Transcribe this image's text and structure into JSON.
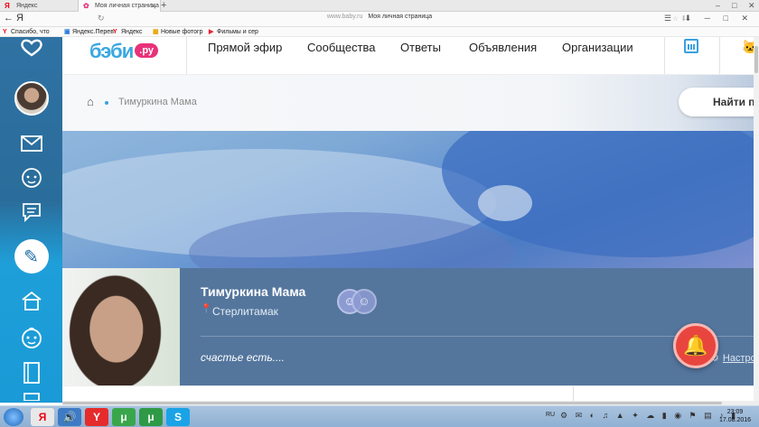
{
  "browser": {
    "tabs": [
      {
        "label": "Яндекс",
        "icon": "yandex-icon"
      },
      {
        "label": "Моя личная страница",
        "icon": "baby-site-icon",
        "active": true
      }
    ],
    "new_tab": "+",
    "back": "←",
    "brand_letter": "Я",
    "reload": "↻",
    "url_host": "www.baby.ru",
    "url_title": "Моя личная страница",
    "bookmarks": [
      {
        "label": "Спасибо, что",
        "icon": "yandex-y-icon",
        "color": "#e01"
      },
      {
        "label": "Яндекс.Перев",
        "icon": "translate-icon",
        "color": "#2a7ad8"
      },
      {
        "label": "Яндекс",
        "icon": "yandex-y-icon",
        "color": "#e01"
      },
      {
        "label": "Новые фотогр",
        "icon": "photo-icon",
        "color": "#e8a300"
      },
      {
        "label": "Фильмы и сер",
        "icon": "film-icon",
        "color": "#e23"
      }
    ]
  },
  "site": {
    "logo_text": "бэби",
    "logo_suffix": ".ру",
    "nav": [
      "Прямой эфир",
      "Сообщества",
      "Ответы",
      "Объявления",
      "Организации"
    ],
    "breadcrumb_current": "Тимуркина Мама",
    "search_button": "Найти п"
  },
  "profile": {
    "name": "Тимуркина Мама",
    "city": "Стерлитамак",
    "status": "счастье есть....",
    "settings_label": "Настро"
  },
  "taskbar": {
    "lang": "RU",
    "time": "23:09",
    "date": "17.08.2016",
    "apps": [
      {
        "label": "Я",
        "icon": "yandex-browser-icon",
        "color": "#e8e8e8",
        "text_color": "#e01"
      },
      {
        "label": "🔊",
        "icon": "media-player-icon",
        "color": "#3e7bc4",
        "text_color": "#fff"
      },
      {
        "label": "Y",
        "icon": "yandex-icon",
        "color": "#e52b2b",
        "text_color": "#fff"
      },
      {
        "label": "μ",
        "icon": "utorrent-icon",
        "color": "#3aa64b",
        "text_color": "#fff"
      },
      {
        "label": "μ",
        "icon": "utorrent-icon-2",
        "color": "#2f9a45",
        "text_color": "#fff"
      },
      {
        "label": "S",
        "icon": "skype-icon",
        "color": "#1aa3e6",
        "text_color": "#fff"
      }
    ]
  },
  "colors": {
    "accent": "#3aa0df",
    "logo_badge": "#e8327a",
    "profile_bar": "#54769d",
    "notification_bell": "#e9453f"
  }
}
